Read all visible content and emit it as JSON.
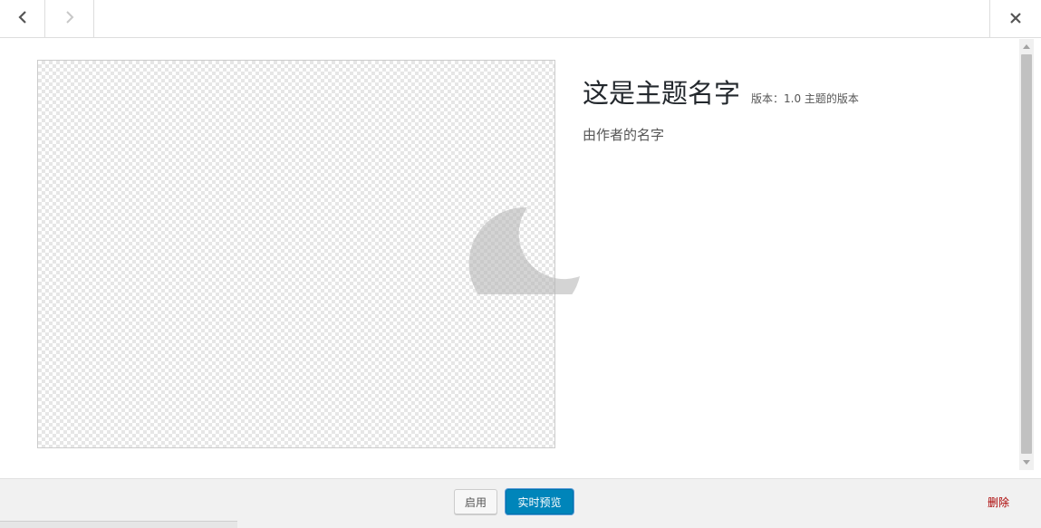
{
  "nav": {
    "prev_icon": "chevron-left-icon",
    "next_icon": "chevron-right-icon",
    "close_icon": "close-icon"
  },
  "theme": {
    "name": "这是主题名字",
    "version": "版本：1.0 主题的版本",
    "author": "由作者的名字"
  },
  "actions": {
    "activate_label": "启用",
    "preview_label": "实时预览",
    "delete_label": "删除"
  },
  "colors": {
    "primary_button": "#0085ba",
    "delete_link": "#aa0000"
  }
}
